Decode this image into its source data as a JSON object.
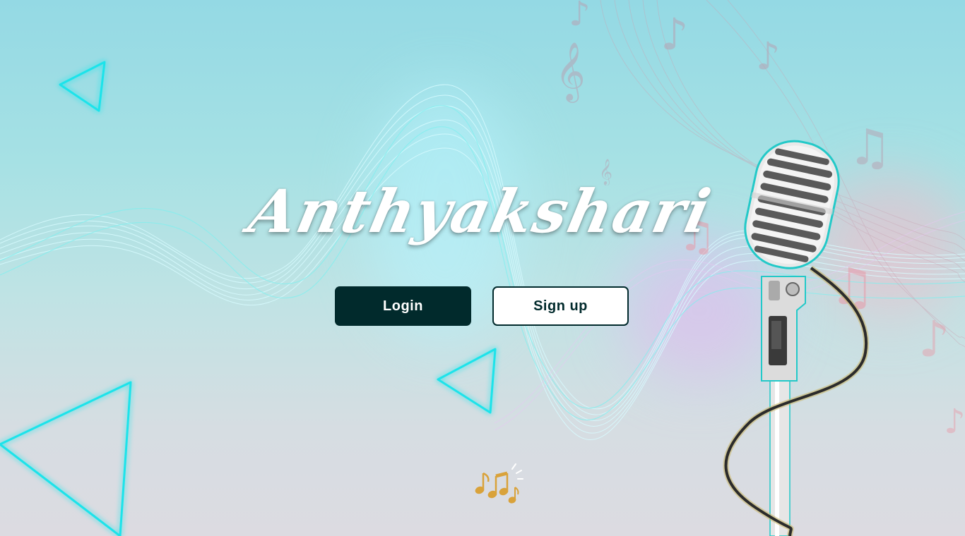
{
  "app": {
    "title": "Anthyakshari"
  },
  "actions": {
    "login_label": "Login",
    "signup_label": "Sign up"
  },
  "decor": {
    "triangle_icon": "play-triangle-icon",
    "microphone_icon": "microphone-icon",
    "music_notes_icon": "music-notes-icon"
  },
  "colors": {
    "primary": "#012a2c",
    "accent_cyan": "#20e0e8",
    "note_pink": "#e89aa8",
    "gold": "#d9a23a"
  }
}
